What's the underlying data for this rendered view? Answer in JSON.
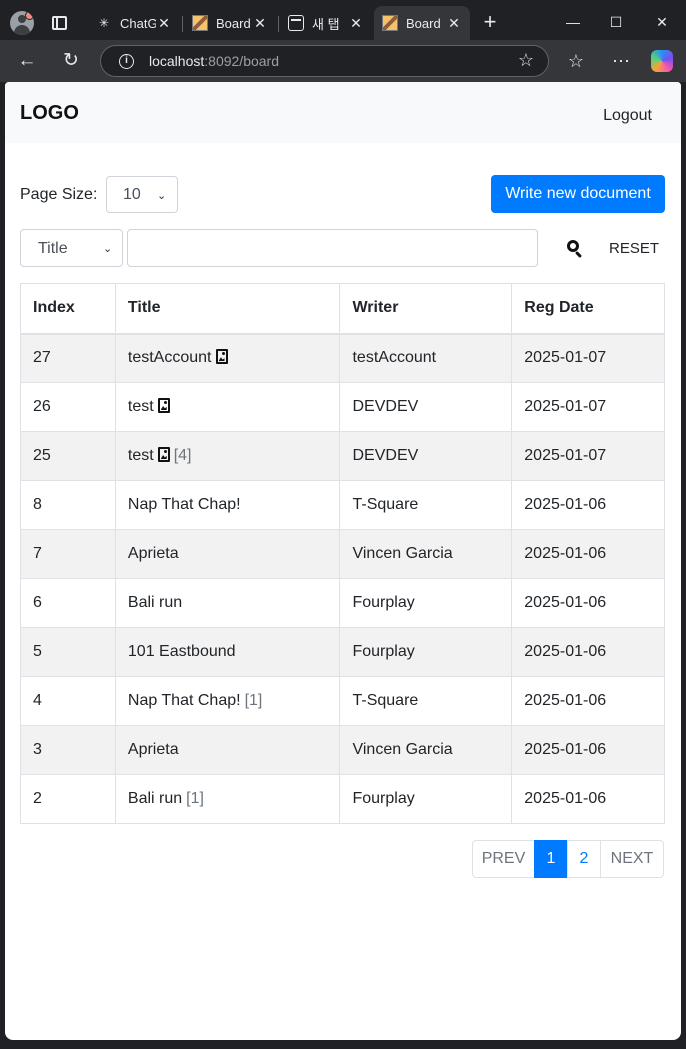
{
  "browser": {
    "tabs": [
      {
        "title": "ChatGPT",
        "favicon": "chatgpt-icon"
      },
      {
        "title": "Board",
        "favicon": "board-favicon"
      },
      {
        "title": "새 탭",
        "favicon": "new-tab-icon"
      },
      {
        "title": "Board",
        "favicon": "board-favicon",
        "active": true
      }
    ],
    "url_host": "localhost",
    "url_rest": ":8092/board"
  },
  "header": {
    "logo": "LOGO",
    "logout": "Logout"
  },
  "controls": {
    "page_size_label": "Page Size:",
    "page_size_value": "10",
    "write_button": "Write new document",
    "search_type": "Title",
    "search_value": "",
    "reset_button": "RESET"
  },
  "table": {
    "headers": [
      "Index",
      "Title",
      "Writer",
      "Reg Date"
    ],
    "rows": [
      {
        "index": "27",
        "title": "testAccount",
        "file": true,
        "count": "",
        "writer": "testAccount",
        "date": "2025-01-07"
      },
      {
        "index": "26",
        "title": "test",
        "file": true,
        "count": "",
        "writer": "DEVDEV",
        "date": "2025-01-07"
      },
      {
        "index": "25",
        "title": "test",
        "file": true,
        "count": "[4]",
        "writer": "DEVDEV",
        "date": "2025-01-07"
      },
      {
        "index": "8",
        "title": "Nap That Chap!",
        "file": false,
        "count": "",
        "writer": "T-Square",
        "date": "2025-01-06"
      },
      {
        "index": "7",
        "title": "Aprieta",
        "file": false,
        "count": "",
        "writer": "Vincen Garcia",
        "date": "2025-01-06"
      },
      {
        "index": "6",
        "title": "Bali run",
        "file": false,
        "count": "",
        "writer": "Fourplay",
        "date": "2025-01-06"
      },
      {
        "index": "5",
        "title": "101 Eastbound",
        "file": false,
        "count": "",
        "writer": "Fourplay",
        "date": "2025-01-06"
      },
      {
        "index": "4",
        "title": "Nap That Chap!",
        "file": false,
        "count": "[1]",
        "writer": "T-Square",
        "date": "2025-01-06"
      },
      {
        "index": "3",
        "title": "Aprieta",
        "file": false,
        "count": "",
        "writer": "Vincen Garcia",
        "date": "2025-01-06"
      },
      {
        "index": "2",
        "title": "Bali run",
        "file": false,
        "count": "[1]",
        "writer": "Fourplay",
        "date": "2025-01-06"
      }
    ]
  },
  "pagination": {
    "prev": "PREV",
    "pages": [
      "1",
      "2"
    ],
    "active_page": "1",
    "next": "NEXT"
  },
  "colors": {
    "primary": "#007bff",
    "navbar_bg": "#f8f9fa",
    "stripe": "#f2f2f2"
  }
}
